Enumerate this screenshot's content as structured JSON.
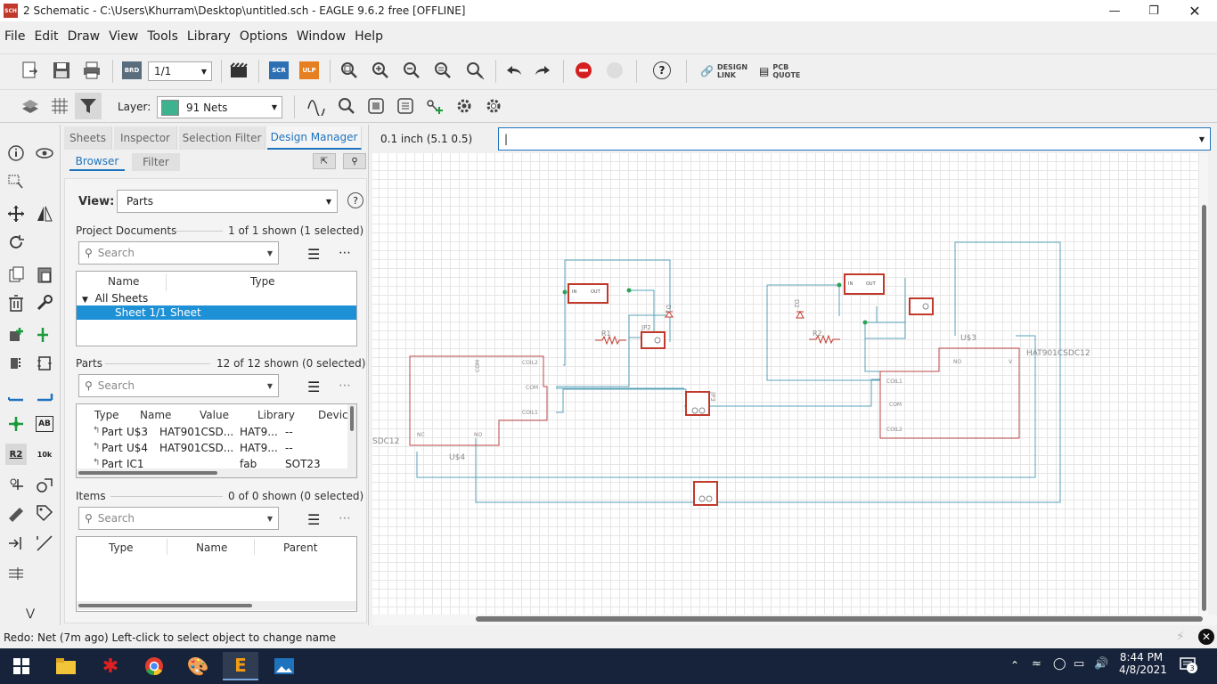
{
  "window": {
    "title": "2 Schematic - C:\\Users\\Khurram\\Desktop\\untitled.sch - EAGLE 9.6.2 free [OFFLINE]",
    "app_badge": "SCH"
  },
  "menu": [
    "File",
    "Edit",
    "Draw",
    "View",
    "Tools",
    "Library",
    "Options",
    "Window",
    "Help"
  ],
  "toolbar": {
    "sheet_select": "1/1",
    "brd_label": "BRD",
    "scr_label": "SCR",
    "ulp_label": "ULP",
    "help_label": "?",
    "design_link": "DESIGN LINK",
    "pcb_quote": "PCB QUOTE"
  },
  "toolbar2": {
    "layer_label": "Layer:",
    "layer_value": "91 Nets",
    "layer_color": "#3cb28e"
  },
  "leftbar": {
    "name_label": "R2",
    "value_label": "10k",
    "text_label": "AB"
  },
  "panel": {
    "tabs": [
      "Sheets",
      "Inspector",
      "Selection Filter",
      "Design Manager"
    ],
    "subtabs": [
      "Browser",
      "Filter"
    ],
    "view_label": "View:",
    "view_value": "Parts",
    "project": {
      "title": "Project Documents",
      "count": "1 of 1 shown (1 selected)",
      "search_placeholder": "Search",
      "columns": [
        "Name",
        "Type"
      ],
      "tree_root": "All Sheets",
      "rows": [
        {
          "name": "Sheet 1/1",
          "type": "Sheet"
        }
      ]
    },
    "parts": {
      "title": "Parts",
      "count": "12 of 12 shown (0 selected)",
      "search_placeholder": "Search",
      "columns": [
        "Type",
        "Name",
        "Value",
        "Library",
        "Devic"
      ],
      "rows": [
        {
          "type": "Part",
          "name": "U$3",
          "value": "HAT901CSD...",
          "library": "HAT9...",
          "device": "--"
        },
        {
          "type": "Part",
          "name": "U$4",
          "value": "HAT901CSD...",
          "library": "HAT9...",
          "device": "--"
        },
        {
          "type": "Part",
          "name": "IC1",
          "value": "",
          "library": "fab",
          "device": "SOT23"
        }
      ]
    },
    "items": {
      "title": "Items",
      "count": "0 of 0 shown (0 selected)",
      "search_placeholder": "Search",
      "columns": [
        "Type",
        "Name",
        "Parent"
      ]
    }
  },
  "canvas": {
    "grid_info": "0.1 inch (5.1 0.5)",
    "command_value": "|",
    "labels": {
      "u3": "U$3",
      "u4": "U$4",
      "hat_right": "HAT901CSDC12",
      "hat_left": "SDC12",
      "r1": "R1",
      "r2": "R2",
      "jp2": "JP2",
      "jp3": "JP3",
      "d1": "D1",
      "d2": "D2",
      "pin_coil2": "COIL2",
      "pin_com": "COM",
      "pin_coil1": "COIL1",
      "pin_nc": "NC",
      "pin_no": "NO",
      "pin_v": "V",
      "pin_in": "IN",
      "pin_out": "OUT"
    }
  },
  "status": {
    "message": "Redo: Net (7m ago) Left-click to select object to change name"
  },
  "taskbar": {
    "time": "8:44 PM",
    "date": "4/8/2021",
    "notifications": "3"
  }
}
